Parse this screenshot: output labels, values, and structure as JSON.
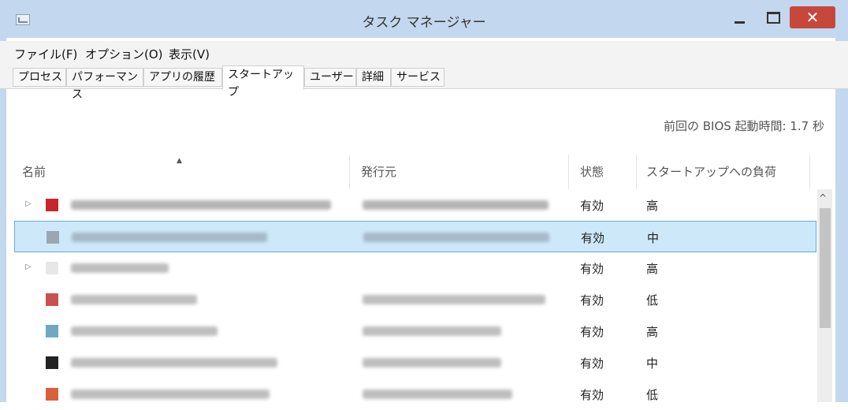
{
  "window": {
    "title": "タスク マネージャー",
    "close_label": "✕"
  },
  "menu": [
    {
      "label": "ファイル(F)"
    },
    {
      "label": "オプション(O)"
    },
    {
      "label": "表示(V)"
    }
  ],
  "tabs": [
    {
      "label": "プロセス"
    },
    {
      "label": "パフォーマンス"
    },
    {
      "label": "アプリの履歴"
    },
    {
      "label": "スタートアップ",
      "active": true
    },
    {
      "label": "ユーザー"
    },
    {
      "label": "詳細"
    },
    {
      "label": "サービス"
    }
  ],
  "bios": {
    "label": "前回の BIOS 起動時間:  1.7 秒"
  },
  "columns": {
    "name": "名前",
    "publisher": "発行元",
    "status": "状態",
    "impact": "スタートアップへの負荷"
  },
  "rows": [
    {
      "status": "有効",
      "impact": "高",
      "expandable": true,
      "selected": false,
      "icon_color": "#c9262b"
    },
    {
      "status": "有効",
      "impact": "中",
      "expandable": false,
      "selected": true,
      "icon_color": "#9aa7b3"
    },
    {
      "status": "有効",
      "impact": "高",
      "expandable": true,
      "selected": false,
      "icon_color": "#e7e7e7"
    },
    {
      "status": "有効",
      "impact": "低",
      "expandable": false,
      "selected": false,
      "icon_color": "#c9524e"
    },
    {
      "status": "有効",
      "impact": "高",
      "expandable": false,
      "selected": false,
      "icon_color": "#6fa8c0"
    },
    {
      "status": "有効",
      "impact": "中",
      "expandable": false,
      "selected": false,
      "icon_color": "#222222"
    },
    {
      "status": "有効",
      "impact": "低",
      "expandable": false,
      "selected": false,
      "icon_color": "#d9603a"
    }
  ],
  "scrollbar": {
    "up_arrow": "^"
  },
  "colors": {
    "titlebar": "#c3d7ef",
    "close_button": "#c7483b",
    "selection": "#cce8f9",
    "selection_border": "#68a9da"
  }
}
